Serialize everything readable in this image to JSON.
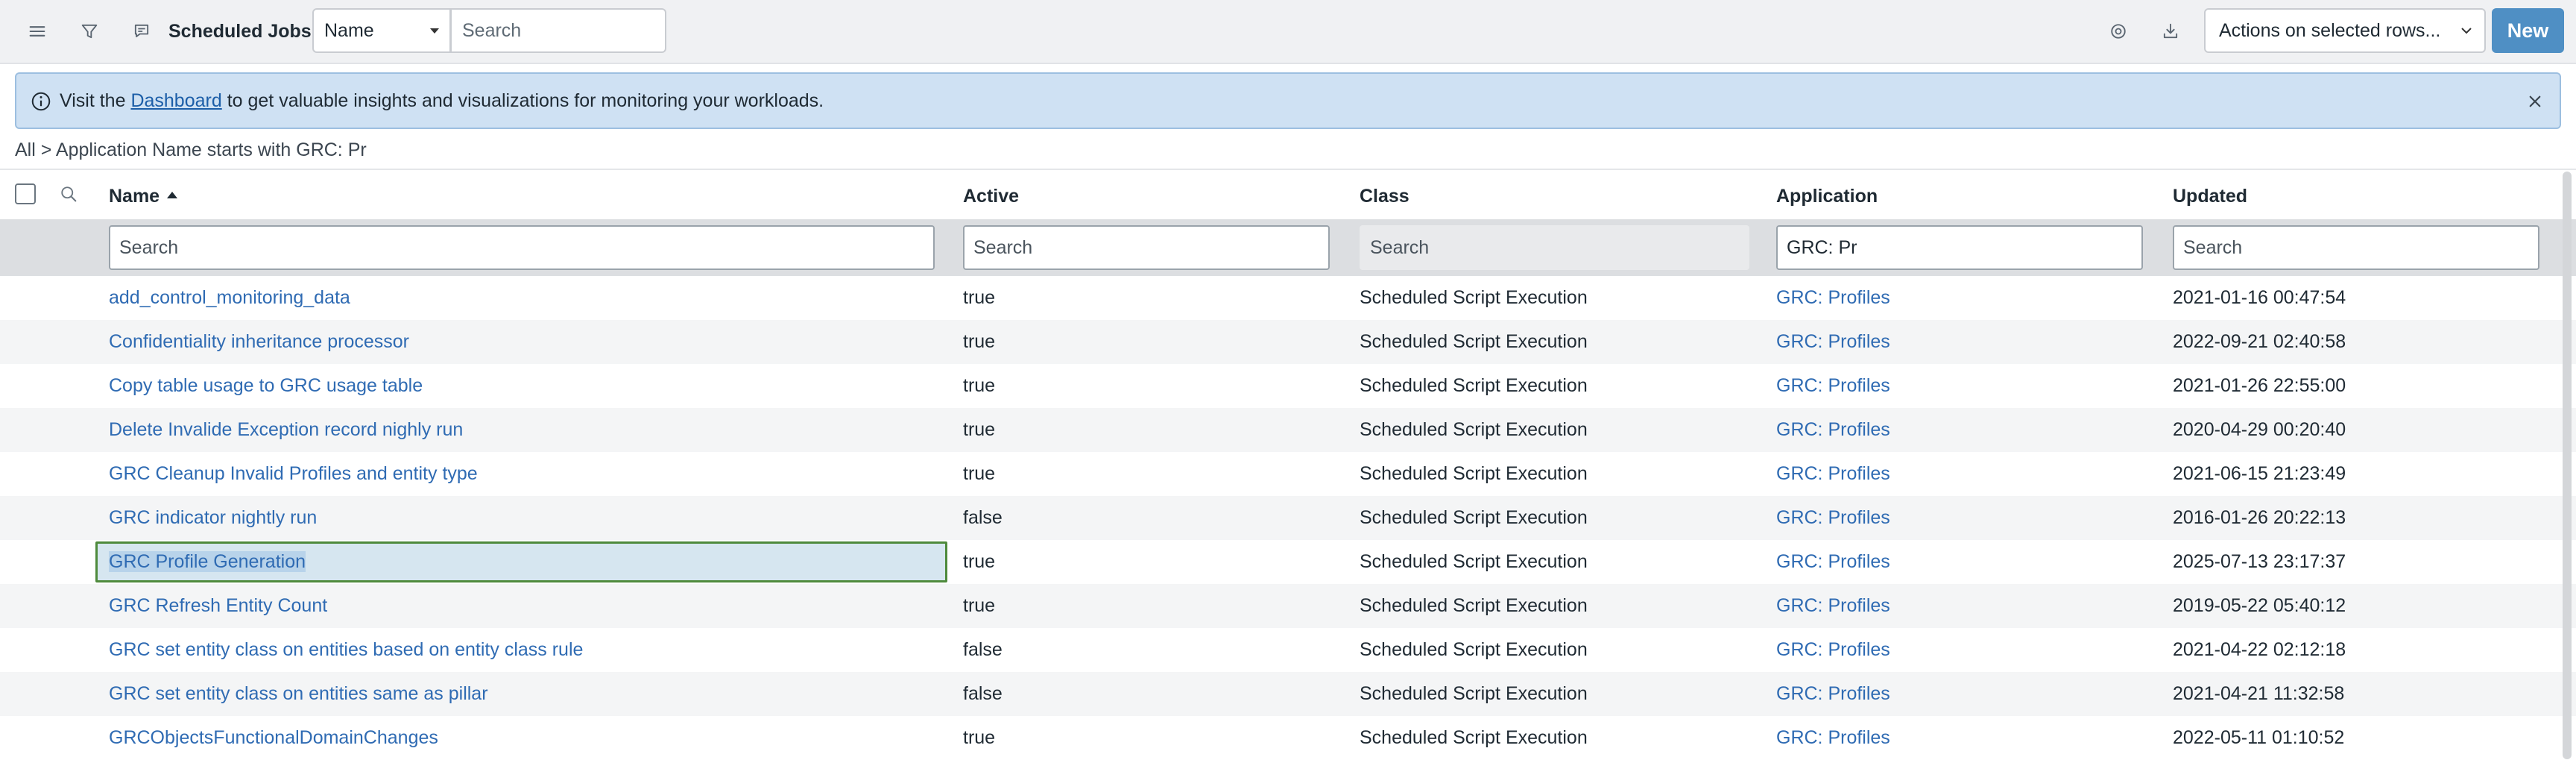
{
  "header": {
    "title": "Scheduled Jobs",
    "field_select": "Name",
    "search_placeholder": "Search",
    "actions_label": "Actions on selected rows...",
    "new_label": "New"
  },
  "banner": {
    "prefix": "Visit the ",
    "link": "Dashboard",
    "suffix": " to get valuable insights and visualizations for monitoring your workloads."
  },
  "breadcrumb": "All > Application Name starts with GRC: Pr",
  "columns": {
    "name": "Name",
    "active": "Active",
    "class": "Class",
    "application": "Application",
    "updated": "Updated"
  },
  "filters": {
    "name_placeholder": "Search",
    "active_placeholder": "Search",
    "class_placeholder": "Search",
    "application_value": "GRC: Pr",
    "updated_placeholder": "Search"
  },
  "rows": [
    {
      "name": "add_control_monitoring_data",
      "active": "true",
      "class": "Scheduled Script Execution",
      "application": "GRC: Profiles",
      "updated": "2021-01-16 00:47:54"
    },
    {
      "name": "Confidentiality inheritance processor",
      "active": "true",
      "class": "Scheduled Script Execution",
      "application": "GRC: Profiles",
      "updated": "2022-09-21 02:40:58"
    },
    {
      "name": "Copy table usage to GRC usage table",
      "active": "true",
      "class": "Scheduled Script Execution",
      "application": "GRC: Profiles",
      "updated": "2021-01-26 22:55:00"
    },
    {
      "name": "Delete Invalide Exception record nighly run",
      "active": "true",
      "class": "Scheduled Script Execution",
      "application": "GRC: Profiles",
      "updated": "2020-04-29 00:20:40"
    },
    {
      "name": "GRC Cleanup Invalid Profiles and entity type",
      "active": "true",
      "class": "Scheduled Script Execution",
      "application": "GRC: Profiles",
      "updated": "2021-06-15 21:23:49"
    },
    {
      "name": "GRC indicator nightly run",
      "active": "false",
      "class": "Scheduled Script Execution",
      "application": "GRC: Profiles",
      "updated": "2016-01-26 20:22:13"
    },
    {
      "name": "GRC Profile Generation",
      "active": "true",
      "class": "Scheduled Script Execution",
      "application": "GRC: Profiles",
      "updated": "2025-07-13 23:17:37"
    },
    {
      "name": "GRC Refresh Entity Count",
      "active": "true",
      "class": "Scheduled Script Execution",
      "application": "GRC: Profiles",
      "updated": "2019-05-22 05:40:12"
    },
    {
      "name": "GRC set entity class on entities based on entity class rule",
      "active": "false",
      "class": "Scheduled Script Execution",
      "application": "GRC: Profiles",
      "updated": "2021-04-22 02:12:18"
    },
    {
      "name": "GRC set entity class on entities same as pillar",
      "active": "false",
      "class": "Scheduled Script Execution",
      "application": "GRC: Profiles",
      "updated": "2021-04-21 11:32:58"
    },
    {
      "name": "GRCObjectsFunctionalDomainChanges",
      "active": "true",
      "class": "Scheduled Script Execution",
      "application": "GRC: Profiles",
      "updated": "2022-05-11 01:10:52"
    }
  ],
  "selected_row": 6,
  "colors": {
    "accent": "#4f8fc4",
    "link": "#2f6bb3",
    "banner_bg": "#cfe1f3",
    "selection_border": "#4e8a3c"
  }
}
